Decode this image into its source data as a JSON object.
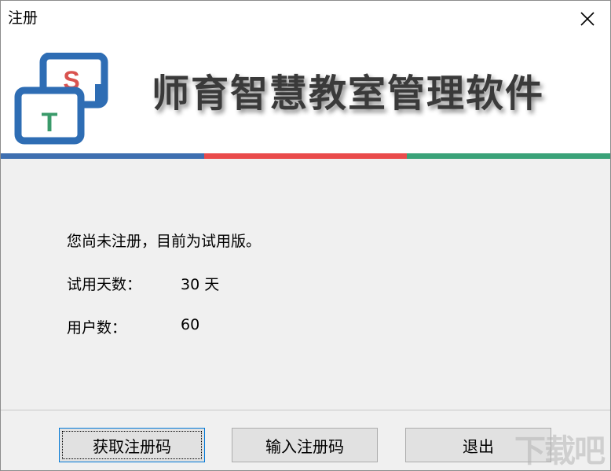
{
  "window": {
    "title": "注册",
    "close_glyph": "✕"
  },
  "banner": {
    "app_name": "师育智慧教室管理软件",
    "logo_letters": {
      "top": "S",
      "bottom": "T"
    },
    "logo_colors": {
      "frame": "#2e6db4",
      "s_letter": "#d9534f",
      "t_letter": "#3a9a6a"
    },
    "color_bar": [
      "#3e6fb0",
      "#e94b4b",
      "#3aa278"
    ]
  },
  "info": {
    "status": "您尚未注册，目前为试用版。",
    "trial_days_label": "试用天数：",
    "trial_days_value": "30 天",
    "users_label": "用户数：",
    "users_value": "60"
  },
  "buttons": {
    "get_code": "获取注册码",
    "enter_code": "输入注册码",
    "exit": "退出"
  },
  "watermark": "下载吧"
}
